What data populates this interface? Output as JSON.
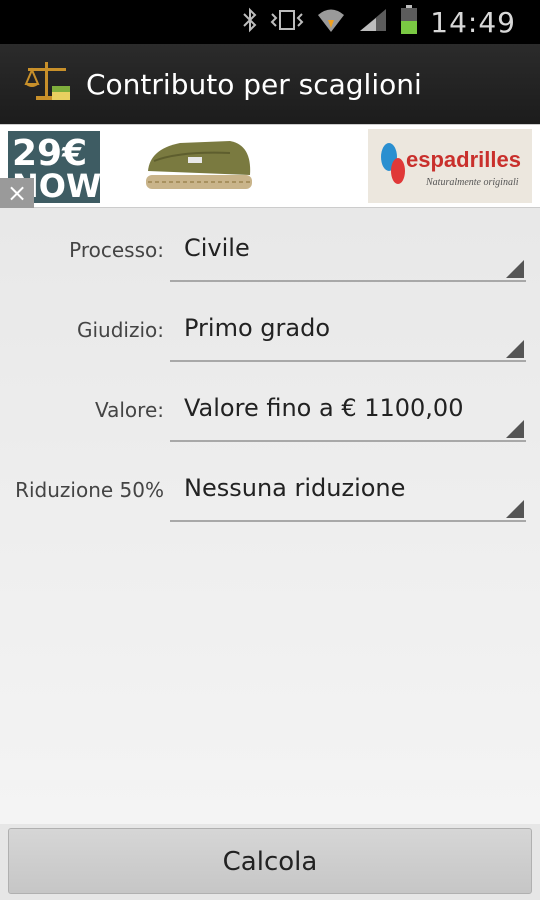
{
  "status_bar": {
    "time": "14:49",
    "icons": [
      "bluetooth-icon",
      "vibrate-icon",
      "wifi-icon",
      "signal-icon",
      "battery-icon"
    ],
    "battery_color": "#7ac943"
  },
  "action_bar": {
    "title": "Contributo per scaglioni",
    "app_icon": "scales-money-icon"
  },
  "ad": {
    "price_line1": "29€",
    "price_line2": "NOW",
    "brand": "espadrilles",
    "tagline": "Naturalmente originali",
    "close_glyph": "×"
  },
  "form": {
    "fields": [
      {
        "label": "Processo:",
        "value": "Civile"
      },
      {
        "label": "Giudizio:",
        "value": "Primo grado"
      },
      {
        "label": "Valore:",
        "value": "Valore fino a € 1100,00"
      },
      {
        "label": "Riduzione 50%",
        "value": "Nessuna riduzione"
      }
    ]
  },
  "footer": {
    "calc_label": "Calcola"
  }
}
